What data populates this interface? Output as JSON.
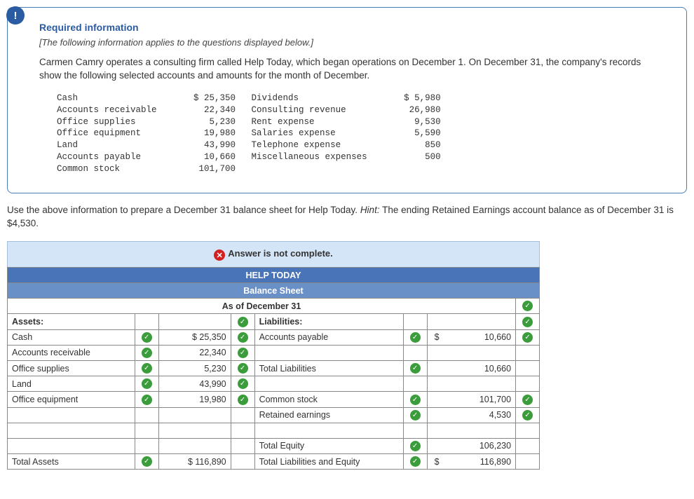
{
  "card": {
    "title": "Required information",
    "italic": "[The following information applies to the questions displayed below.]",
    "body": "Carmen Camry operates a consulting firm called Help Today, which began operations on December 1. On December 31, the company's records show the following selected accounts and amounts for the month of December.",
    "accounts_left": [
      {
        "name": "Cash",
        "amt": "$ 25,350"
      },
      {
        "name": "Accounts receivable",
        "amt": "22,340"
      },
      {
        "name": "Office supplies",
        "amt": "5,230"
      },
      {
        "name": "Office equipment",
        "amt": "19,980"
      },
      {
        "name": "Land",
        "amt": "43,990"
      },
      {
        "name": "Accounts payable",
        "amt": "10,660"
      },
      {
        "name": "Common stock",
        "amt": "101,700"
      }
    ],
    "accounts_right": [
      {
        "name": "Dividends",
        "amt": "$ 5,980"
      },
      {
        "name": "Consulting revenue",
        "amt": "26,980"
      },
      {
        "name": "Rent expense",
        "amt": "9,530"
      },
      {
        "name": "Salaries expense",
        "amt": "5,590"
      },
      {
        "name": "Telephone expense",
        "amt": "850"
      },
      {
        "name": "Miscellaneous expenses",
        "amt": "500"
      }
    ]
  },
  "instruction": {
    "text": "Use the above information to prepare a December 31 balance sheet for Help Today. ",
    "hint_label": "Hint:",
    "hint_text": " The ending Retained Earnings account balance as of December 31 is $4,530."
  },
  "banner": "Answer is not complete.",
  "sheet": {
    "company": "HELP TODAY",
    "title": "Balance Sheet",
    "date": "As of December 31",
    "assets_label": "Assets:",
    "liab_label": "Liabilities:",
    "rows_assets": [
      {
        "label": "Cash",
        "sym": "$",
        "val": "25,350"
      },
      {
        "label": "Accounts receivable",
        "sym": "",
        "val": "22,340"
      },
      {
        "label": "Office supplies",
        "sym": "",
        "val": "5,230"
      },
      {
        "label": "Land",
        "sym": "",
        "val": "43,990"
      },
      {
        "label": "Office equipment",
        "sym": "",
        "val": "19,980"
      }
    ],
    "total_assets_label": "Total Assets",
    "total_assets_val": "$   116,890",
    "rows_liab": [
      {
        "label": "Accounts payable",
        "sym": "$",
        "val": "10,660"
      }
    ],
    "total_liab_label": "Total Liabilities",
    "total_liab_val": "10,660",
    "equity": [
      {
        "label": "Common stock",
        "val": "101,700"
      },
      {
        "label": "Retained earnings",
        "val": "4,530"
      }
    ],
    "total_equity_label": "Total Equity",
    "total_equity_val": "106,230",
    "total_le_label": "Total Liabilities and Equity",
    "total_le_sym": "$",
    "total_le_val": "116,890"
  }
}
